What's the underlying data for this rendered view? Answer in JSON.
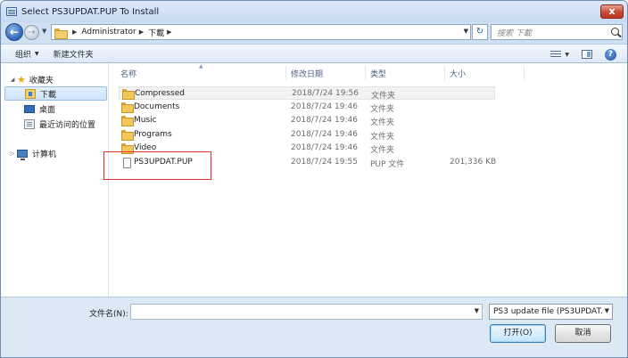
{
  "window": {
    "title": "Select PS3UPDAT.PUP To Install",
    "close_glyph": "x"
  },
  "nav": {
    "breadcrumbs": [
      "Administrator",
      "下載"
    ],
    "search_placeholder": "搜索 下載"
  },
  "toolbar": {
    "organize_label": "组织",
    "new_folder_label": "新建文件夹"
  },
  "sidebar": {
    "favorites_label": "收藏夹",
    "items": [
      {
        "label": "下載"
      },
      {
        "label": "桌面"
      },
      {
        "label": "最近访问的位置"
      }
    ],
    "computer_label": "计算机"
  },
  "columns": {
    "name": "名称",
    "date": "修改日期",
    "type": "类型",
    "size": "大小"
  },
  "files": [
    {
      "name": "Compressed",
      "date": "2018/7/24 19:56",
      "type": "文件夹",
      "size": "",
      "kind": "folder"
    },
    {
      "name": "Documents",
      "date": "2018/7/24 19:46",
      "type": "文件夹",
      "size": "",
      "kind": "folder"
    },
    {
      "name": "Music",
      "date": "2018/7/24 19:46",
      "type": "文件夹",
      "size": "",
      "kind": "folder"
    },
    {
      "name": "Programs",
      "date": "2018/7/24 19:46",
      "type": "文件夹",
      "size": "",
      "kind": "folder"
    },
    {
      "name": "Video",
      "date": "2018/7/24 19:46",
      "type": "文件夹",
      "size": "",
      "kind": "folder"
    },
    {
      "name": "PS3UPDAT.PUP",
      "date": "2018/7/24 19:55",
      "type": "PUP 文件",
      "size": "201,336 KB",
      "kind": "file"
    }
  ],
  "footer": {
    "filename_label": "文件名(N):",
    "filename_value": "",
    "filetype_value": "PS3 update file (PS3UPDAT.",
    "open_label": "打开(O)",
    "cancel_label": "取消"
  },
  "colors": {
    "highlight_box": "#e0302a",
    "accent": "#2d63b3"
  }
}
